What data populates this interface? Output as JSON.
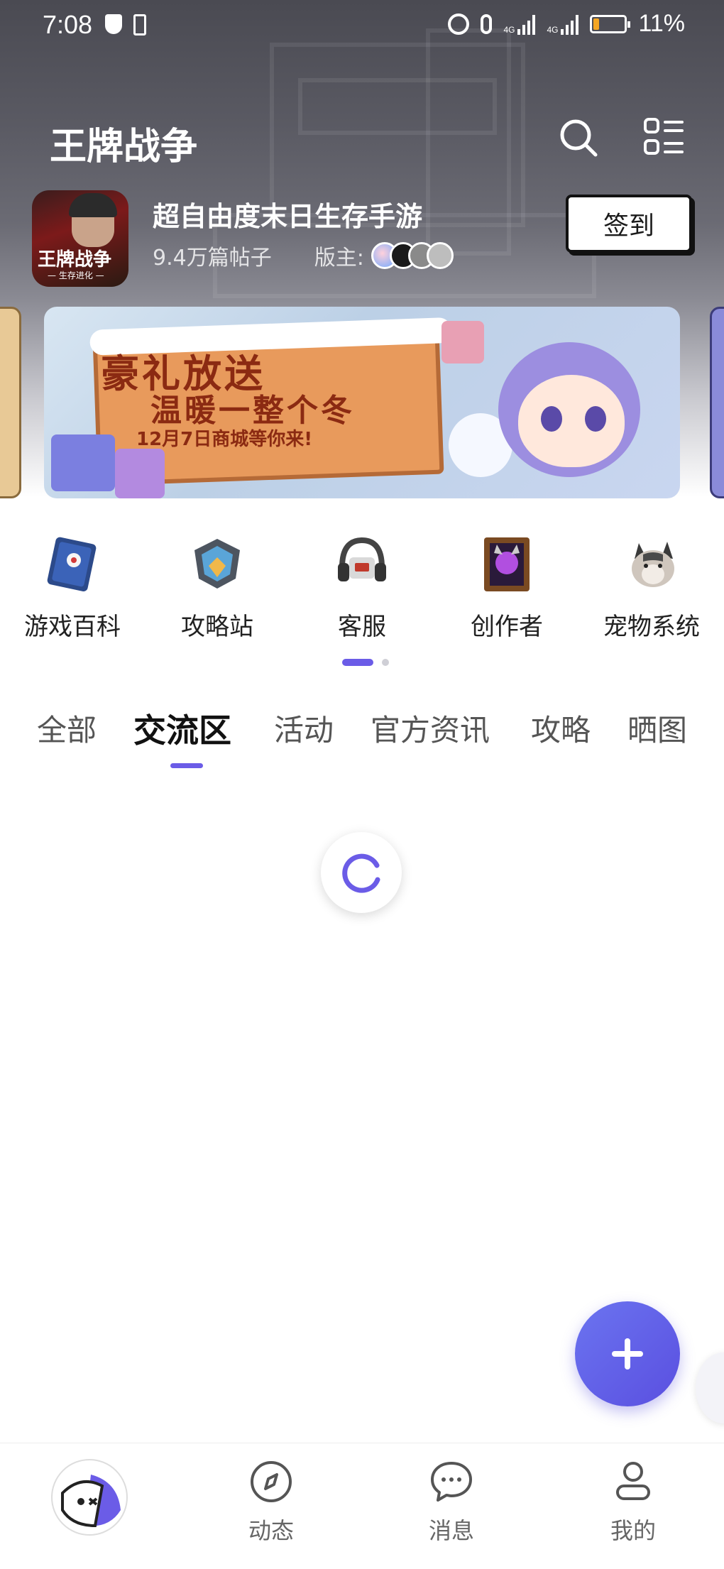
{
  "status_bar": {
    "time": "7:08",
    "network_1": "4G",
    "network_2": "4G",
    "battery": "11%",
    "battery_level": 0.11
  },
  "header": {
    "title": "王牌战争",
    "search_icon": "search-icon",
    "menu_icon": "grid-menu-icon"
  },
  "game": {
    "icon_text": "王牌战争",
    "icon_subtext": "— 生存进化 —",
    "name": "超自由度末日生存手游",
    "posts": "9.4万篇帖子",
    "moderator_label": "版主:",
    "checkin_label": "签到"
  },
  "banner": {
    "line1": "豪礼放送",
    "line2": "温暖一整个冬",
    "line3": "12月7日商城等你来!"
  },
  "shortcuts": [
    {
      "label": "游戏百科",
      "icon": "book-icon"
    },
    {
      "label": "攻略站",
      "icon": "shield-badge-icon"
    },
    {
      "label": "客服",
      "icon": "headset-icon"
    },
    {
      "label": "创作者",
      "icon": "portrait-frame-icon"
    },
    {
      "label": "宠物系统",
      "icon": "cat-icon"
    }
  ],
  "tabs": [
    {
      "label": "全部"
    },
    {
      "label": "交流区"
    },
    {
      "label": "活动"
    },
    {
      "label": "官方资讯"
    },
    {
      "label": "攻略"
    },
    {
      "label": "晒图"
    }
  ],
  "active_tab": "交流区",
  "fab_icon": "plus-icon",
  "bottom_nav": [
    {
      "label": "",
      "icon": "home-avatar-icon"
    },
    {
      "label": "动态",
      "icon": "compass-icon"
    },
    {
      "label": "消息",
      "icon": "chat-bubble-icon"
    },
    {
      "label": "我的",
      "icon": "user-icon"
    }
  ],
  "colors": {
    "accent": "#6b5ce7",
    "fab": "#5a4fe0"
  }
}
